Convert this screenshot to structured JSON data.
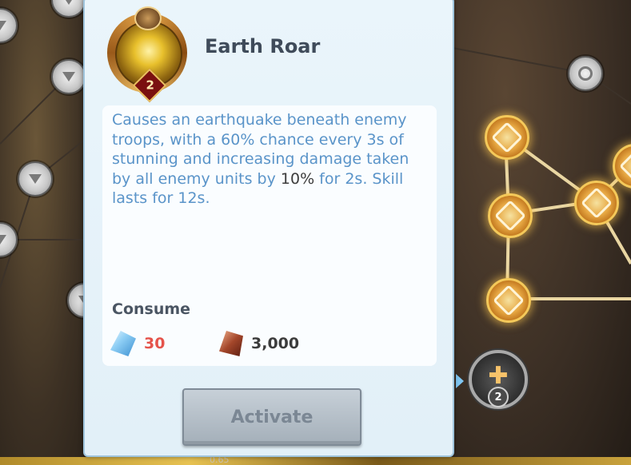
{
  "skill": {
    "name": "Earth Roar",
    "level": "2",
    "description_parts": {
      "before": "Causes an earthquake beneath enemy troops, with a 60% chance every 3s of stunning and increasing damage taken by all enemy units by ",
      "highlight": "10%",
      "after": " for 2s. Skill lasts for 12s."
    }
  },
  "consume": {
    "label": "Consume",
    "items": [
      {
        "icon": "crystal-icon",
        "value": "30",
        "color": "#e5534b"
      },
      {
        "icon": "ore-icon",
        "value": "3,000",
        "color": "#3c3c3c"
      }
    ]
  },
  "actions": {
    "activate_label": "Activate"
  },
  "tree": {
    "selected_node_level": "2"
  },
  "footer": {
    "label": "0.65"
  },
  "colors": {
    "panel_bg": "#e2f0f8",
    "description_text": "#5a94c9",
    "title_text": "#3f4b5a",
    "button_disabled": "#a4afb9"
  }
}
